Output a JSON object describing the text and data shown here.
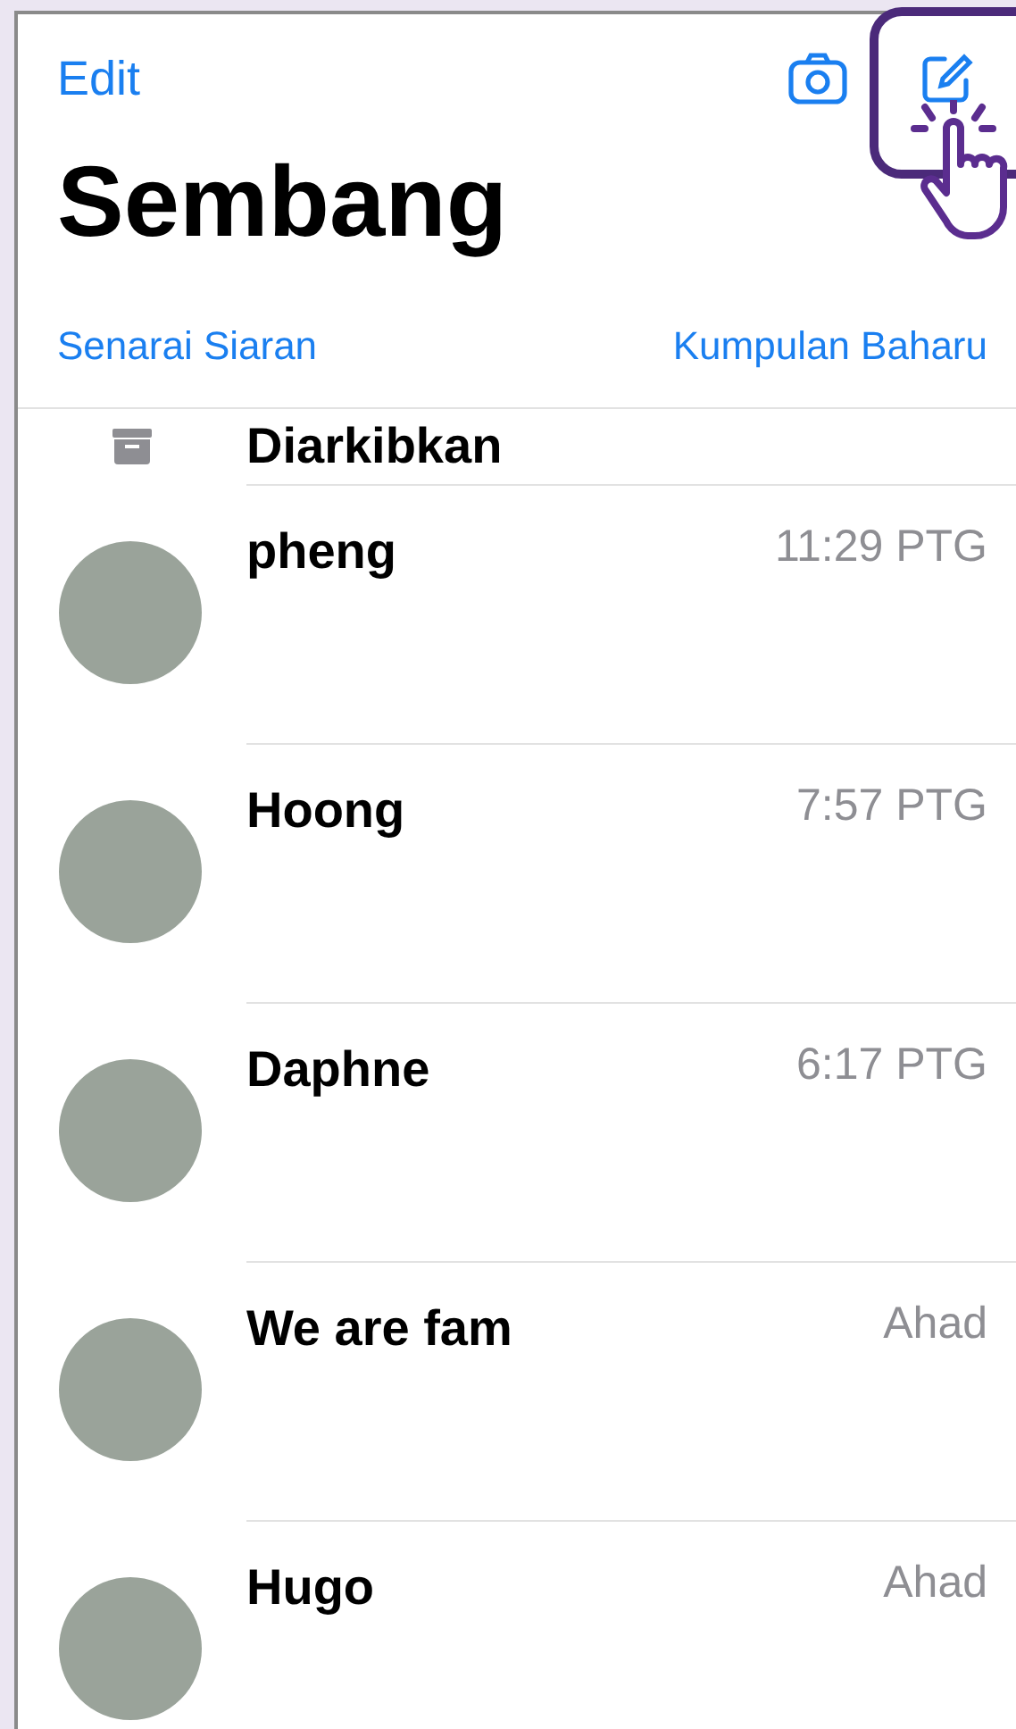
{
  "header": {
    "edit": "Edit",
    "title": "Sembang"
  },
  "links": {
    "left": "Senarai Siaran",
    "right": "Kumpulan Baharu"
  },
  "archived": {
    "label": "Diarkibkan"
  },
  "chats": [
    {
      "name": "pheng",
      "time": "11:29 PTG"
    },
    {
      "name": "Hoong",
      "time": "7:57 PTG"
    },
    {
      "name": "Daphne",
      "time": "6:17 PTG"
    },
    {
      "name": "We are fam",
      "time": "Ahad"
    },
    {
      "name": "Hugo",
      "time": "Ahad"
    }
  ]
}
